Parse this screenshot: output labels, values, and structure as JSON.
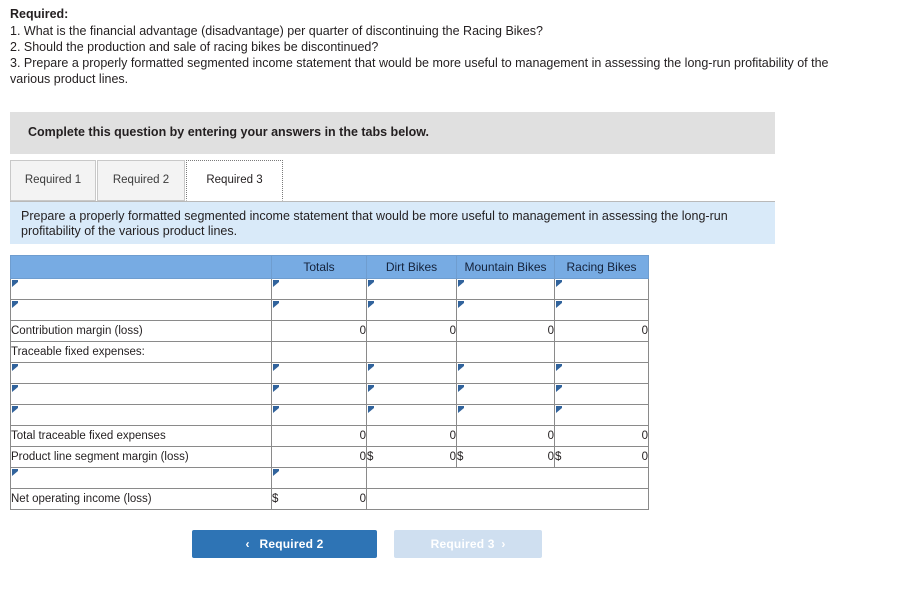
{
  "prompt": {
    "heading": "Required:",
    "questions": [
      "1. What is the financial advantage (disadvantage) per quarter of discontinuing the Racing Bikes?",
      "2. Should the production and sale of racing bikes be discontinued?",
      "3. Prepare a properly formatted segmented income statement that would be more useful to management in assessing the long-run profitability of the various product lines."
    ]
  },
  "banner": {
    "text": "Complete this question by entering your answers in the tabs below."
  },
  "tabs": {
    "items": [
      {
        "label": "Required 1",
        "active": false
      },
      {
        "label": "Required 2",
        "active": false
      },
      {
        "label": "Required 3",
        "active": true
      }
    ]
  },
  "sub_instruction": {
    "text": "Prepare a properly formatted segmented income statement that would be more useful to management in assessing the long-run profitability of the various product lines."
  },
  "sheet": {
    "columns": [
      "",
      "Totals",
      "Dirt Bikes",
      "Mountain Bikes",
      "Racing Bikes"
    ],
    "rows": [
      {
        "type": "entry",
        "label": "",
        "totals": "",
        "dirt": "",
        "mountain": "",
        "racing": ""
      },
      {
        "type": "entry",
        "label": "",
        "totals": "",
        "dirt": "",
        "mountain": "",
        "racing": ""
      },
      {
        "type": "value",
        "label": "Contribution margin (loss)",
        "totals": "0",
        "dirt": "0",
        "mountain": "0",
        "racing": "0",
        "rule": "top"
      },
      {
        "type": "value",
        "label": "Traceable fixed expenses:",
        "totals": "",
        "dirt": "",
        "mountain": "",
        "racing": ""
      },
      {
        "type": "entry",
        "label": "",
        "totals": "",
        "dirt": "",
        "mountain": "",
        "racing": ""
      },
      {
        "type": "entry",
        "label": "",
        "totals": "",
        "dirt": "",
        "mountain": "",
        "racing": ""
      },
      {
        "type": "entry",
        "label": "",
        "totals": "",
        "dirt": "",
        "mountain": "",
        "racing": ""
      },
      {
        "type": "value",
        "label": "Total traceable fixed expenses",
        "totals": "0",
        "dirt": "0",
        "mountain": "0",
        "racing": "0",
        "rule": "top"
      },
      {
        "type": "value",
        "label": "Product line segment margin (loss)",
        "totals": "0",
        "dirt": "0",
        "mountain": "0",
        "racing": "0",
        "dollar": true,
        "rule": "bottom"
      },
      {
        "type": "entry-totals",
        "label": "",
        "totals": ""
      },
      {
        "type": "value-totals",
        "label": "Net operating income (loss)",
        "totals": "0",
        "dollar": true,
        "rule": "bottom"
      }
    ],
    "currency_symbol": "$"
  },
  "nav": {
    "prev_label": "Required 2",
    "prev_icon": "chevron-left-icon",
    "prev_glyph": "‹",
    "next_label": "Required 3",
    "next_icon": "chevron-right-icon",
    "next_glyph": "›"
  },
  "colors": {
    "header_blue": "#77abe3",
    "panel_blue": "#d9eaf9",
    "banner_gray": "#e0e0e0",
    "button_blue": "#2e74b5",
    "button_disabled": "#cfdff0",
    "entry_border": "#6f9dcf"
  }
}
